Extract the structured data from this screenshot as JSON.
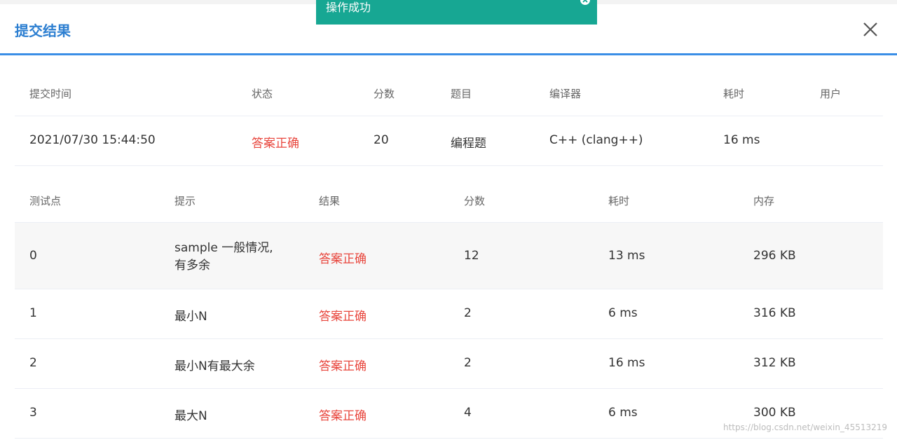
{
  "dialog": {
    "title": "提交结果"
  },
  "toast": {
    "message": "操作成功"
  },
  "summary": {
    "headers": [
      "提交时间",
      "状态",
      "分数",
      "题目",
      "编译器",
      "耗时",
      "用户"
    ],
    "row": [
      "2021/07/30 15:44:50",
      "答案正确",
      "20",
      "编程题",
      "C++ (clang++)",
      "16 ms",
      ""
    ]
  },
  "tests": {
    "headers": [
      "测试点",
      "提示",
      "结果",
      "分数",
      "耗时",
      "内存"
    ],
    "rows": [
      {
        "id": "0",
        "hint": "sample 一般情况,\n有多余",
        "result": "答案正确",
        "score": "12",
        "time": "13 ms",
        "memory": "296 KB"
      },
      {
        "id": "1",
        "hint": "最小N",
        "result": "答案正确",
        "score": "2",
        "time": "6 ms",
        "memory": "316 KB"
      },
      {
        "id": "2",
        "hint": "最小N有最大余",
        "result": "答案正确",
        "score": "2",
        "time": "16 ms",
        "memory": "312 KB"
      },
      {
        "id": "3",
        "hint": "最大N",
        "result": "答案正确",
        "score": "4",
        "time": "6 ms",
        "memory": "300 KB"
      }
    ]
  },
  "watermark": "https://blog.csdn.net/weixin_45513219",
  "colors": {
    "accent": "#2d7fd1",
    "success": "#e8453c",
    "toast": "#17a793"
  },
  "icons": {
    "close": "close-icon",
    "toast_close": "toast-close-icon"
  }
}
